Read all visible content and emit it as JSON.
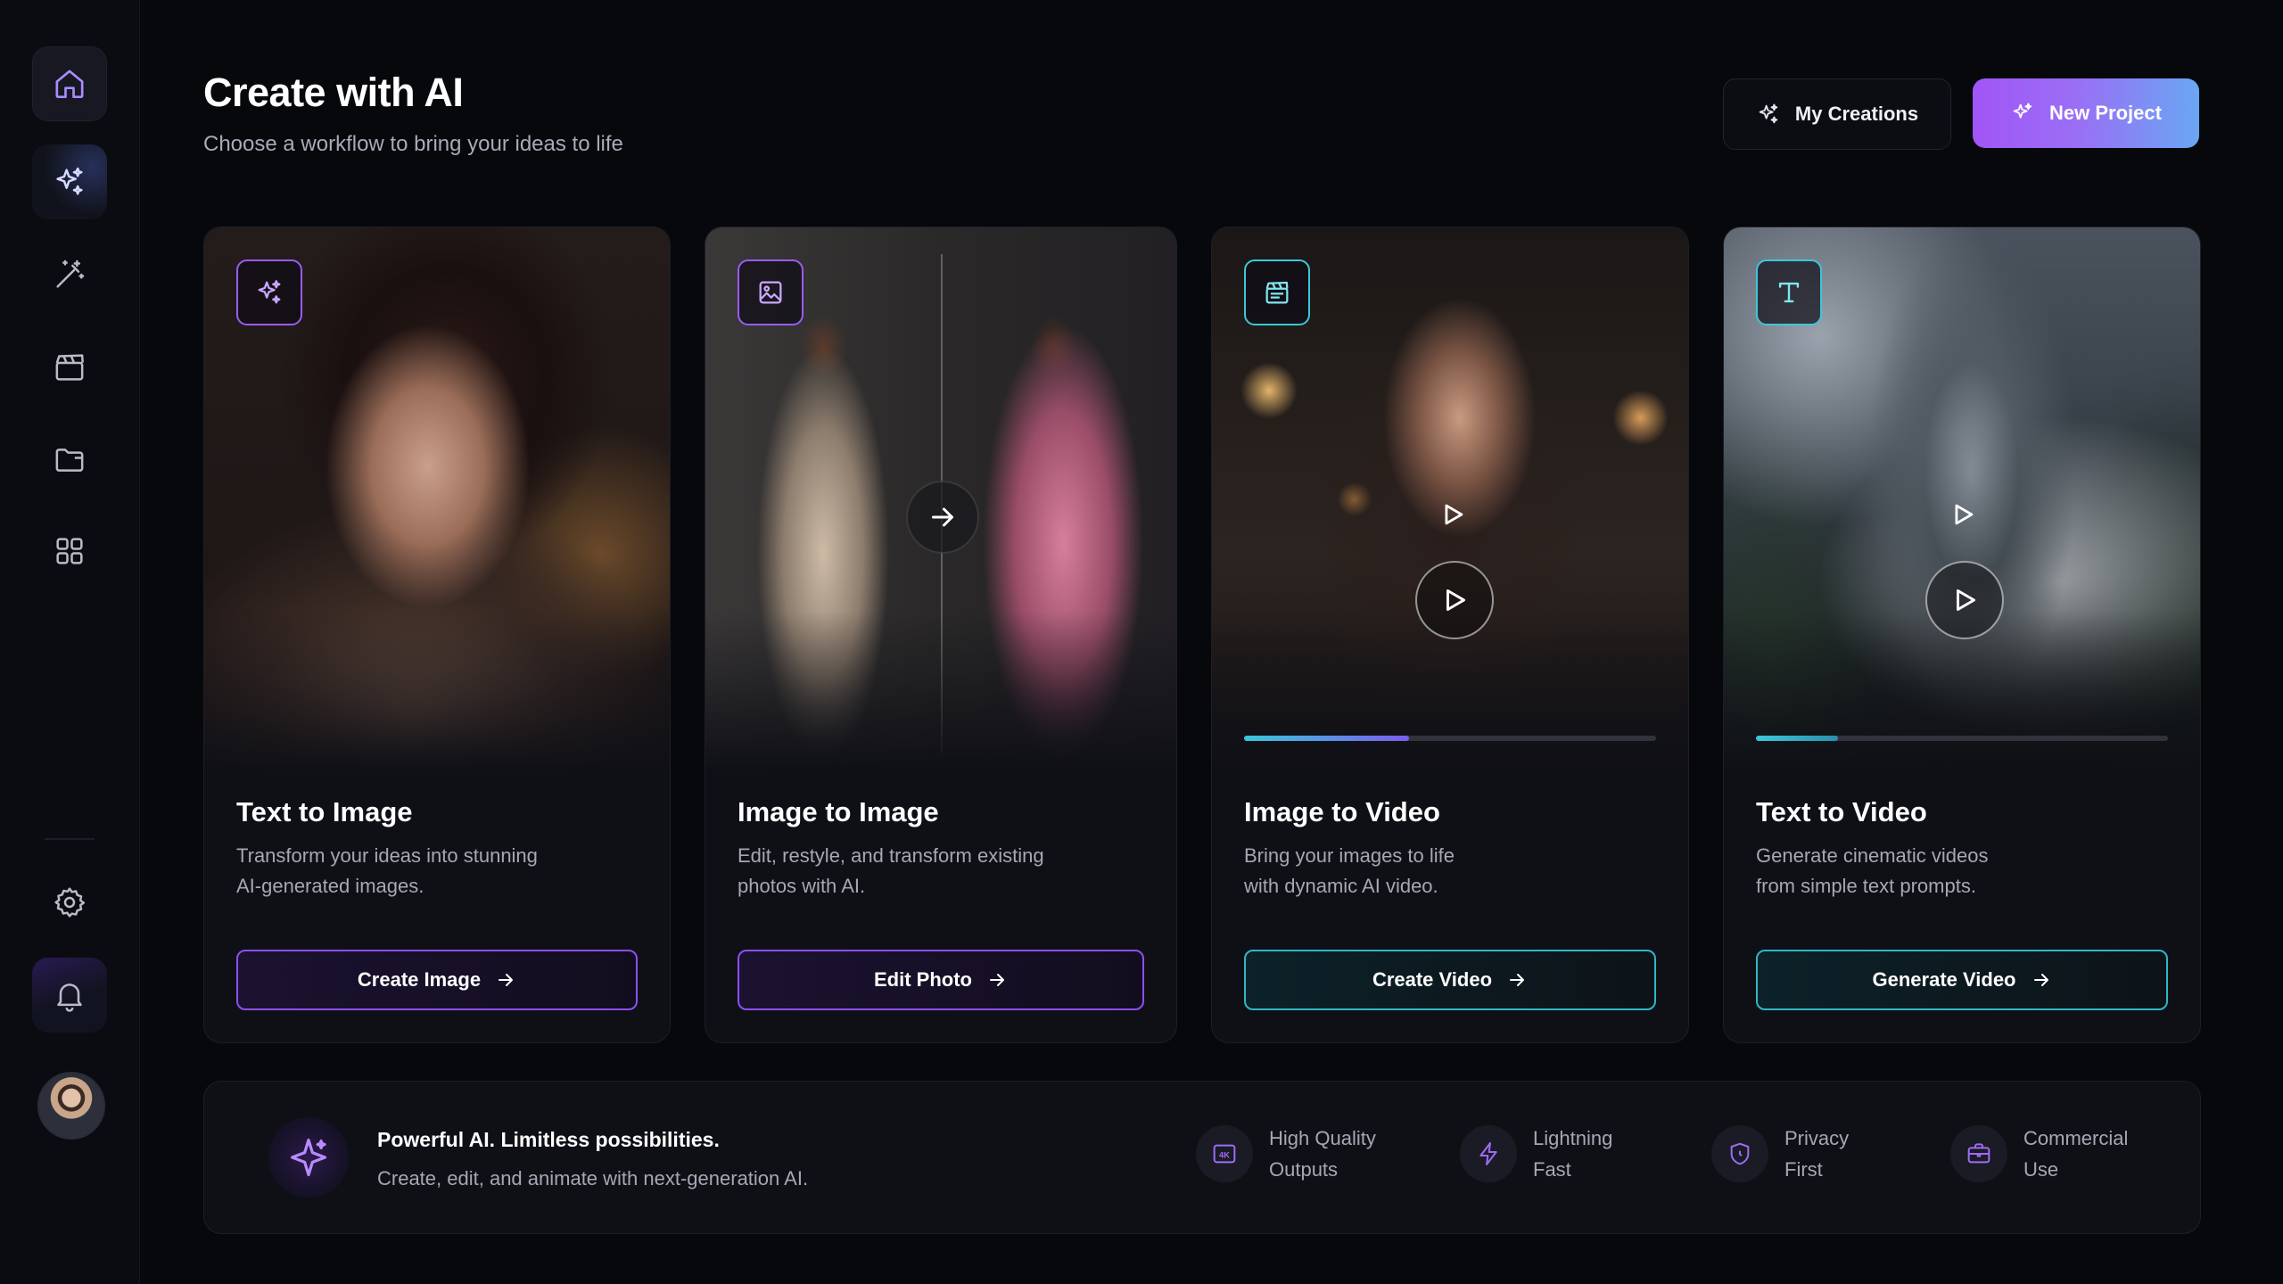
{
  "header": {
    "title": "Create with AI",
    "subtitle": "Choose a workflow to bring your ideas to life",
    "my_creations_label": "My Creations",
    "new_project_label": "New Project"
  },
  "sidebar": {
    "items": [
      {
        "name": "home",
        "icon": "home-icon",
        "active": true
      },
      {
        "name": "ai-generate",
        "icon": "sparkles-icon"
      },
      {
        "name": "edit",
        "icon": "magic-wand-icon"
      },
      {
        "name": "video",
        "icon": "clapperboard-icon"
      },
      {
        "name": "projects",
        "icon": "folder-icon"
      },
      {
        "name": "apps",
        "icon": "grid-icon"
      }
    ],
    "bottom_items": [
      {
        "name": "settings",
        "icon": "gear-icon"
      },
      {
        "name": "notifications",
        "icon": "bell-icon"
      }
    ]
  },
  "cards": [
    {
      "title": "Text to Image",
      "description": "Transform your ideas into stunning\nAI-generated images.",
      "button_label": "Create Image",
      "icon": "sparkles-icon",
      "accent": "#9a5cf6"
    },
    {
      "title": "Image to Image",
      "description": "Edit, restyle, and transform existing\nphotos with AI.",
      "button_label": "Edit Photo",
      "icon": "image-icon",
      "accent": "#9a5cf6"
    },
    {
      "title": "Image to Video",
      "description": "Bring your images to life\nwith dynamic AI video.",
      "button_label": "Create Video",
      "icon": "clapperboard-icon",
      "accent": "#3cc7d9",
      "progress": 0.4
    },
    {
      "title": "Text to Video",
      "description": "Generate cinematic videos\nfrom simple text prompts.",
      "button_label": "Generate Video",
      "icon": "text-t-icon",
      "accent": "#3cc7d9",
      "progress": 0.2
    }
  ],
  "banner": {
    "title": "Powerful AI. Limitless possibilities.",
    "subtitle": "Create, edit, and animate with next-generation AI.",
    "features": [
      {
        "label": "High Quality\nOutputs",
        "icon": "4k-icon"
      },
      {
        "label": "Lightning\nFast",
        "icon": "lightning-icon"
      },
      {
        "label": "Privacy\nFirst",
        "icon": "shield-icon"
      },
      {
        "label": "Commercial\nUse",
        "icon": "briefcase-icon"
      }
    ]
  },
  "colors": {
    "background": "#07080c",
    "purple_accent": "#a155f7",
    "cyan_accent": "#3cc7d9"
  }
}
